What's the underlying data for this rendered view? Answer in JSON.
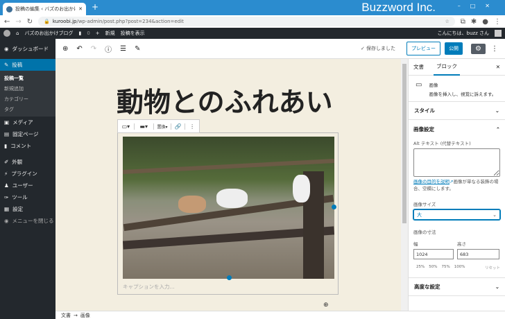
{
  "browser": {
    "tab_title": "投稿の編集 ‹ バズのお出かけブログ —",
    "brand": "Buzzword Inc.",
    "url_host": "kuroobi.jp",
    "url_path": "/wp-admin/post.php?post=234&action=edit"
  },
  "adminbar": {
    "site": "バズのお出かけブログ",
    "comments": "0",
    "new": "新規",
    "view": "投稿を表示",
    "greeting": "こんにちは、buzz さん"
  },
  "sidebar": {
    "items": [
      {
        "label": "ダッシュボード",
        "icon": "dashboard-icon"
      },
      {
        "label": "投稿",
        "icon": "pin-icon",
        "active": true
      },
      {
        "label": "メディア",
        "icon": "media-icon"
      },
      {
        "label": "固定ページ",
        "icon": "page-icon"
      },
      {
        "label": "コメント",
        "icon": "comment-icon"
      },
      {
        "label": "外観",
        "icon": "brush-icon"
      },
      {
        "label": "プラグイン",
        "icon": "plugin-icon"
      },
      {
        "label": "ユーザー",
        "icon": "user-icon"
      },
      {
        "label": "ツール",
        "icon": "wrench-icon"
      },
      {
        "label": "設定",
        "icon": "settings-icon"
      },
      {
        "label": "メニューを閉じる",
        "icon": "collapse-icon"
      }
    ],
    "submenu": [
      "投稿一覧",
      "新規追加",
      "カテゴリー",
      "タグ"
    ]
  },
  "toolbar": {
    "saved": "保存しました",
    "preview": "プレビュー",
    "publish": "公開"
  },
  "post": {
    "title": "動物とのふれあい",
    "caption_placeholder": "キャプションを入力...",
    "block_replace": "置換"
  },
  "panel": {
    "tabs": [
      "文書",
      "ブロック"
    ],
    "active_tab": "ブロック",
    "block_name": "画像",
    "block_desc": "画像を挿入し、視覚に訴えます。",
    "style": "スタイル",
    "image_settings": "画像設定",
    "alt_label": "Alt テキスト (代替テキスト)",
    "alt_value": "",
    "alt_link": "画像の目的を説明",
    "alt_help": "画像が単なる装飾の場合、空欄にします。",
    "size_label": "画像サイズ",
    "size_value": "大",
    "dims_label": "画像の寸法",
    "width_label": "幅",
    "height_label": "高さ",
    "width": "1024",
    "height": "683",
    "percents": [
      "25%",
      "50%",
      "75%",
      "100%"
    ],
    "reset": "リセット",
    "advanced": "高度な設定"
  },
  "footer": {
    "crumbs": [
      "文書",
      "画像"
    ],
    "sep": "→"
  },
  "colors": {
    "accent": "#007cba",
    "admin": "#23282d",
    "canvas": "#f3eee0"
  }
}
